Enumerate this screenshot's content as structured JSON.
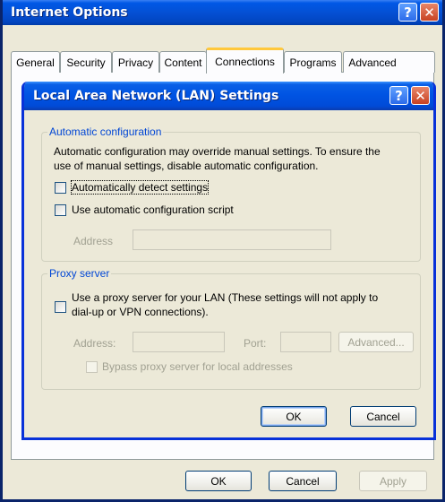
{
  "outer_window": {
    "title": "Internet Options",
    "help_glyph": "?",
    "close_glyph": "✕"
  },
  "tabs": [
    {
      "label": "General",
      "active": false
    },
    {
      "label": "Security",
      "active": false
    },
    {
      "label": "Privacy",
      "active": false
    },
    {
      "label": "Content",
      "active": false
    },
    {
      "label": "Connections",
      "active": true
    },
    {
      "label": "Programs",
      "active": false
    },
    {
      "label": "Advanced",
      "active": false
    }
  ],
  "outer_buttons": {
    "ok": "OK",
    "cancel": "Cancel",
    "apply": "Apply"
  },
  "dialog": {
    "title": "Local Area Network (LAN) Settings",
    "help_glyph": "?",
    "close_glyph": "✕",
    "auto_config": {
      "legend": "Automatic configuration",
      "description_line1": "Automatic configuration may override manual settings.  To ensure the",
      "description_line2": "use of manual settings, disable automatic configuration.",
      "detect_label": "Automatically detect settings",
      "detect_checked": false,
      "script_label": "Use automatic configuration script",
      "script_checked": false,
      "address_label": "Address",
      "address_value": ""
    },
    "proxy": {
      "legend": "Proxy server",
      "use_proxy_line1": "Use a proxy server for your LAN (These settings will not apply to",
      "use_proxy_line2": "dial-up or VPN connections).",
      "use_proxy_checked": false,
      "address_label": "Address:",
      "address_value": "",
      "port_label": "Port:",
      "port_value": "",
      "advanced_button": "Advanced...",
      "bypass_label": "Bypass proxy server for local addresses",
      "bypass_checked": false
    },
    "buttons": {
      "ok": "OK",
      "cancel": "Cancel"
    }
  },
  "colors": {
    "titlebar_blue": "#0054e3",
    "window_face": "#ece9d8",
    "group_legend": "#0046d5",
    "disabled_text": "#a1a192",
    "active_tab_accent": "#ffc83c"
  }
}
